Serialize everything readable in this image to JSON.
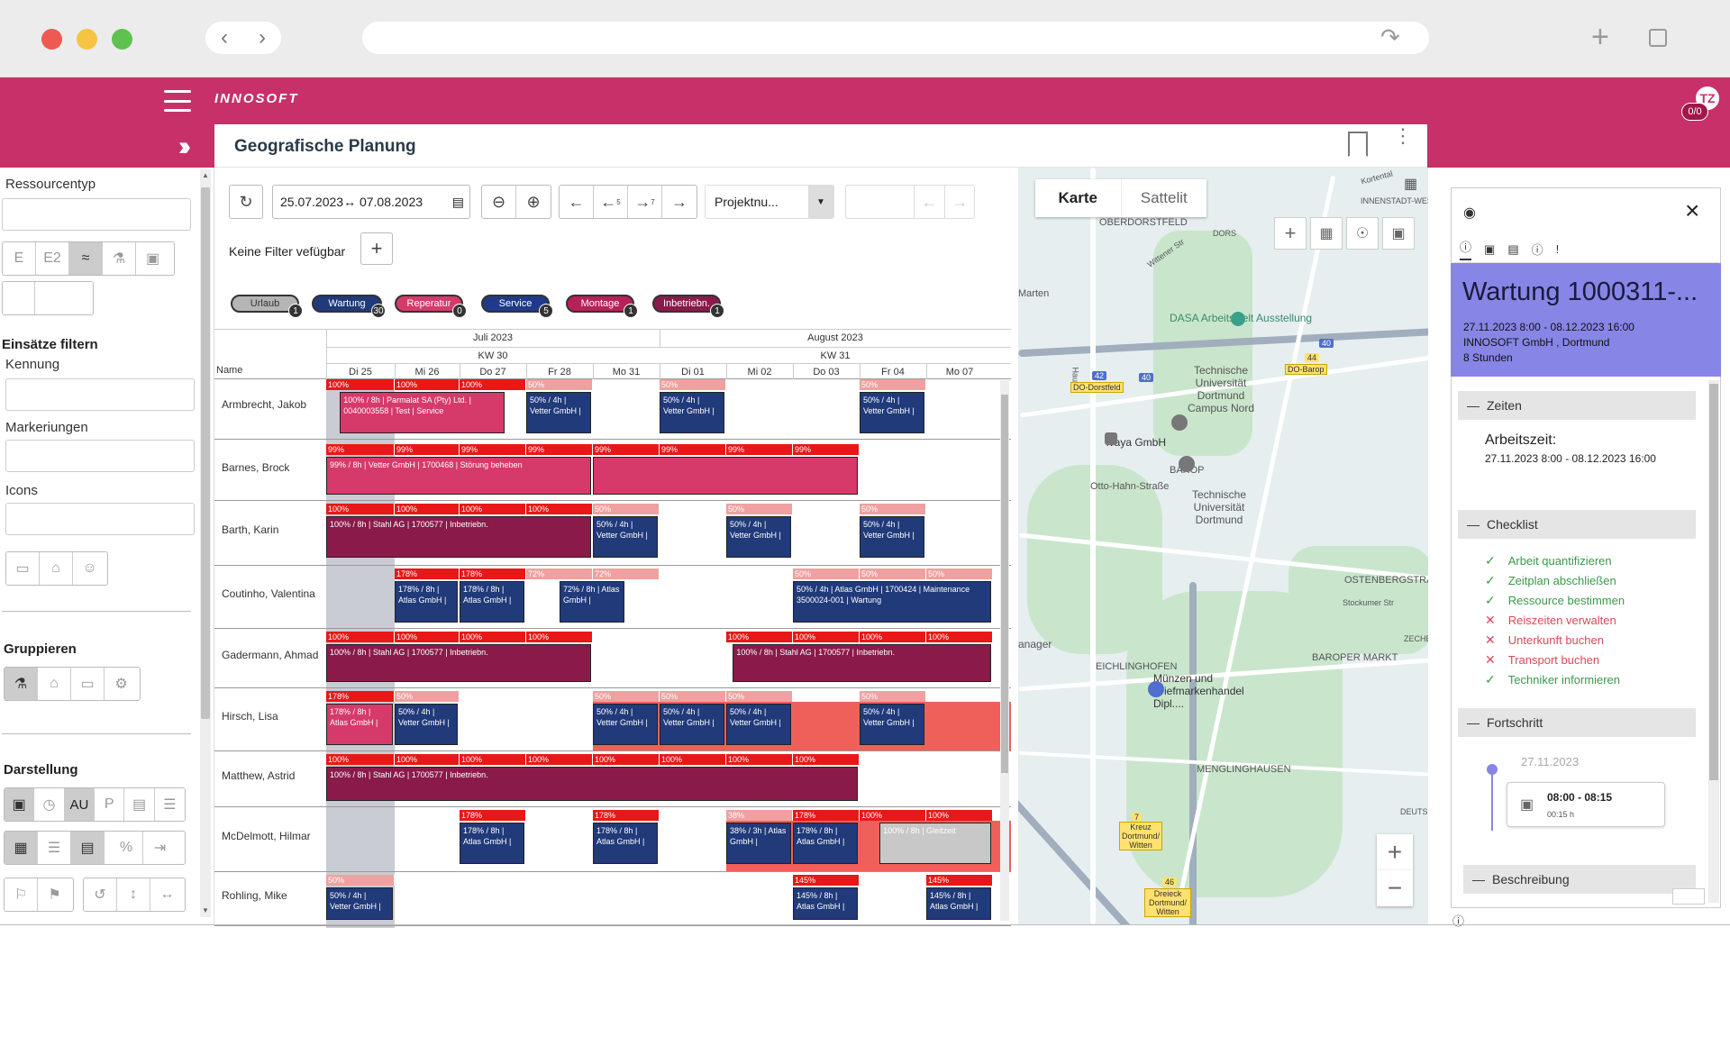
{
  "app": {
    "logo": "INNOSOFT",
    "page_title": "Geografische Planung",
    "avatar": "TZ",
    "badge": "0/0"
  },
  "sidebar": {
    "resource_type_label": "Ressourcentyp",
    "type_buttons": [
      "E",
      "E2"
    ],
    "filter_heading": "Einsätze filtern",
    "kennung_label": "Kennung",
    "markierungen_label": "Markeriungen",
    "icons_label": "Icons",
    "group_heading": "Gruppieren",
    "display_heading": "Darstellung",
    "au_label": "AU",
    "p_label": "P"
  },
  "toolbar": {
    "date_range": "25.07.2023↔ 07.08.2023",
    "step_back": "5",
    "step_fwd": "7",
    "project_select": "Projektnu...",
    "filter_text": "Keine Filter vefügbar"
  },
  "pills": [
    {
      "label": "Urlaub",
      "count": "1",
      "color": "#b5b5b5",
      "text": "#333"
    },
    {
      "label": "Wartung",
      "count": "30",
      "color": "#203a7a",
      "text": "#fff"
    },
    {
      "label": "Reperatur",
      "count": "0",
      "color": "#d63a6a",
      "text": "#fff"
    },
    {
      "label": "Service",
      "count": "5",
      "color": "#203a8a",
      "text": "#fff"
    },
    {
      "label": "Montage",
      "count": "1",
      "color": "#b8205a",
      "text": "#fff"
    },
    {
      "label": "Inbetriebn.",
      "count": "1",
      "color": "#8a1a4a",
      "text": "#fff"
    }
  ],
  "gantt": {
    "name_header": "Name",
    "months": [
      "Juli 2023",
      "August 2023"
    ],
    "weeks": [
      "KW 30",
      "KW 31"
    ],
    "days": [
      "Di 25",
      "Mi 26",
      "Do 27",
      "Fr 28",
      "Mo 31",
      "Di 01",
      "Mi 02",
      "Do 03",
      "Fr 04",
      "Mo 07"
    ],
    "rows": [
      {
        "name": "Armbrecht, Jakob"
      },
      {
        "name": "Barnes, Brock"
      },
      {
        "name": "Barth, Karin"
      },
      {
        "name": "Coutinho, Valentina"
      },
      {
        "name": "Gadermann, Ahmad"
      },
      {
        "name": "Hirsch, Lisa"
      },
      {
        "name": "Matthew, Astrid"
      },
      {
        "name": "McDelmott, Hilmar"
      },
      {
        "name": "Rohling, Mike"
      }
    ],
    "util": [
      [
        "100%",
        "100%",
        "100%",
        "50%",
        "",
        "50%",
        "",
        "",
        "50%",
        ""
      ],
      [
        "99%",
        "99%",
        "99%",
        "99%",
        "99%",
        "99%",
        "99%",
        "99%",
        "",
        ""
      ],
      [
        "100%",
        "100%",
        "100%",
        "100%",
        "50%",
        "",
        "50%",
        "",
        "50%",
        ""
      ],
      [
        "",
        "178%",
        "178%",
        "72%",
        "72%",
        "",
        "",
        "50%",
        "50%",
        "50%"
      ],
      [
        "100%",
        "100%",
        "100%",
        "100%",
        "",
        "",
        "100%",
        "100%",
        "100%",
        "100%"
      ],
      [
        "178%",
        "50%",
        "",
        "",
        "50%",
        "50%",
        "50%",
        "",
        "50%",
        ""
      ],
      [
        "100%",
        "100%",
        "100%",
        "100%",
        "100%",
        "100%",
        "100%",
        "100%",
        "",
        ""
      ],
      [
        "",
        "",
        "178%",
        "",
        "178%",
        "",
        "38%",
        "178%",
        "100%",
        "100%"
      ],
      [
        "50%",
        "",
        "",
        "",
        "",
        "",
        "",
        "145%",
        "",
        "145%"
      ]
    ],
    "bars": [
      {
        "row": 0,
        "start": 0.2,
        "span": 2.5,
        "color": "#d63a6a",
        "text": "100% / 8h | Parmalat SA (Pty) Ltd. | 0040003558 | Test | Service"
      },
      {
        "row": 0,
        "start": 3,
        "span": 1,
        "color": "#203a7a",
        "text": "50% / 4h | Vetter GmbH |"
      },
      {
        "row": 0,
        "start": 5,
        "span": 1,
        "color": "#203a7a",
        "text": "50% / 4h | Vetter GmbH |"
      },
      {
        "row": 0,
        "start": 8,
        "span": 1,
        "color": "#203a7a",
        "text": "50% / 4h | Vetter GmbH |"
      },
      {
        "row": 1,
        "start": 0,
        "span": 4,
        "color": "#d63a6a",
        "text": "99% / 8h | Vetter GmbH | 1700468 | Störung beheben"
      },
      {
        "row": 1,
        "start": 4,
        "span": 4,
        "color": "#d63a6a",
        "text": ""
      },
      {
        "row": 2,
        "start": 0,
        "span": 4,
        "color": "#8a1a4a",
        "text": "100% / 8h | Stahl AG | 1700577 | Inbetriebn."
      },
      {
        "row": 2,
        "start": 4,
        "span": 1,
        "color": "#203a7a",
        "text": "50% / 4h | Vetter GmbH |"
      },
      {
        "row": 2,
        "start": 6,
        "span": 1,
        "color": "#203a7a",
        "text": "50% / 4h | Vetter GmbH |"
      },
      {
        "row": 2,
        "start": 8,
        "span": 1,
        "color": "#203a7a",
        "text": "50% / 4h | Vetter GmbH |"
      },
      {
        "row": 3,
        "start": 1,
        "span": 1,
        "color": "#203a7a",
        "text": "178% / 8h | Atlas GmbH |"
      },
      {
        "row": 3,
        "start": 2,
        "span": 1,
        "color": "#203a7a",
        "text": "178% / 8h | Atlas GmbH |"
      },
      {
        "row": 3,
        "start": 3.5,
        "span": 1,
        "color": "#203a7a",
        "text": "72% / 8h | Atlas GmbH |"
      },
      {
        "row": 3,
        "start": 7,
        "span": 3,
        "color": "#203a7a",
        "text": "50% / 4h | Atlas GmbH | 1700424 | Maintenance 3500024-001 | Wartung"
      },
      {
        "row": 4,
        "start": 0,
        "span": 4,
        "color": "#8a1a4a",
        "text": "100% / 8h | Stahl AG | 1700577 | Inbetriebn."
      },
      {
        "row": 4,
        "start": 6.1,
        "span": 3.9,
        "color": "#8a1a4a",
        "text": "100% / 8h | Stahl AG | 1700577 | Inbetriebn."
      },
      {
        "row": 5,
        "start": 0,
        "span": 1,
        "color": "#d63a6a",
        "text": "178% / 8h | Atlas GmbH |"
      },
      {
        "row": 5,
        "start": 1,
        "span": 1,
        "color": "#203a7a",
        "text": "50% / 4h | Vetter GmbH |"
      },
      {
        "row": 5,
        "start": 4,
        "span": 1,
        "color": "#203a7a",
        "text": "50% / 4h | Vetter GmbH |"
      },
      {
        "row": 5,
        "start": 5,
        "span": 1,
        "color": "#203a7a",
        "text": "50% / 4h | Vetter GmbH |"
      },
      {
        "row": 5,
        "start": 6,
        "span": 1,
        "color": "#203a7a",
        "text": "50% / 4h | Vetter GmbH |"
      },
      {
        "row": 5,
        "start": 8,
        "span": 1,
        "color": "#203a7a",
        "text": "50% / 4h | Vetter GmbH |"
      },
      {
        "row": 6,
        "start": 0,
        "span": 8,
        "color": "#8a1a4a",
        "text": "100% / 8h | Stahl AG | 1700577 | Inbetriebn."
      },
      {
        "row": 7,
        "start": 2,
        "span": 1,
        "color": "#203a7a",
        "text": "178% / 8h | Atlas GmbH |"
      },
      {
        "row": 7,
        "start": 4,
        "span": 1,
        "color": "#203a7a",
        "text": "178% / 8h | Atlas GmbH |"
      },
      {
        "row": 7,
        "start": 6,
        "span": 1,
        "color": "#203a7a",
        "text": "38% / 3h | Atlas GmbH |"
      },
      {
        "row": 7,
        "start": 7,
        "span": 1,
        "color": "#203a7a",
        "text": "178% / 8h | Atlas GmbH |"
      },
      {
        "row": 7,
        "start": 8.3,
        "span": 1.7,
        "color": "#c8c8c8",
        "text": "100% / 8h | Gleitzeit"
      },
      {
        "row": 8,
        "start": 0,
        "span": 1,
        "color": "#203a7a",
        "text": "50% / 4h | Vetter GmbH |"
      },
      {
        "row": 8,
        "start": 7,
        "span": 1,
        "color": "#203a7a",
        "text": "145% / 8h | Atlas GmbH |"
      },
      {
        "row": 8,
        "start": 9,
        "span": 1,
        "color": "#203a7a",
        "text": "145% / 8h | Atlas GmbH |"
      }
    ]
  },
  "map": {
    "tab_map": "Karte",
    "tab_satellite": "Sattelit",
    "labels": [
      "OBERDORSTFELD",
      "Marten",
      "DASA Arbeitswelt Ausstellung",
      "Technische Universität Dortmund Campus Nord",
      "ivaya GmbH",
      "BAROP",
      "Technische Universität Dortmund",
      "Otto-Hahn-Straße",
      "OSTENBERGSTRASS",
      "BAROPER MARKT",
      "EICHLINGHOFEN",
      "Münzen und Briefmarkenhandel Dipl....",
      "MENGLINGHAUSEN",
      "anager",
      "INNENSTADT-WES",
      "DORS",
      "Kortental",
      "Stockumer Str",
      "ZECHE",
      "DEUTS",
      "Hauert",
      "Wittener Str"
    ],
    "signs": [
      "DO-Dorstfeld",
      "DO-Barop",
      "Kreuz Dortmund/ Witten",
      "Dreieck Dortmund/ Witten"
    ],
    "route_nums": [
      "42",
      "40",
      "40",
      "44",
      "7",
      "46"
    ]
  },
  "detail": {
    "title": "Wartung 1000311-...",
    "timespan": "27.11.2023 8:00 - 08.12.2023 16:00",
    "company": "INNOSOFT GmbH , Dortmund",
    "hours": "8 Stunden",
    "zeiten": "Zeiten",
    "arbeitszeit_label": "Arbeitszeit:",
    "arbeitszeit_value": "27.11.2023 8:00 - 08.12.2023 16:00",
    "checklist": "Checklist",
    "items": [
      {
        "label": "Arbeit quantifizieren",
        "ok": true
      },
      {
        "label": "Zeitplan abschließen",
        "ok": true
      },
      {
        "label": "Ressource bestimmen",
        "ok": true
      },
      {
        "label": "Reiszeiten verwalten",
        "ok": false
      },
      {
        "label": "Unterkunft buchen",
        "ok": false
      },
      {
        "label": "Transport buchen",
        "ok": false
      },
      {
        "label": "Techniker informieren",
        "ok": true
      }
    ],
    "fortschritt": "Fortschritt",
    "progress_date": "27.11.2023",
    "progress_time": "08:00 - 08:15",
    "progress_duration": "00:15 h",
    "beschreibung": "Beschreibung"
  }
}
